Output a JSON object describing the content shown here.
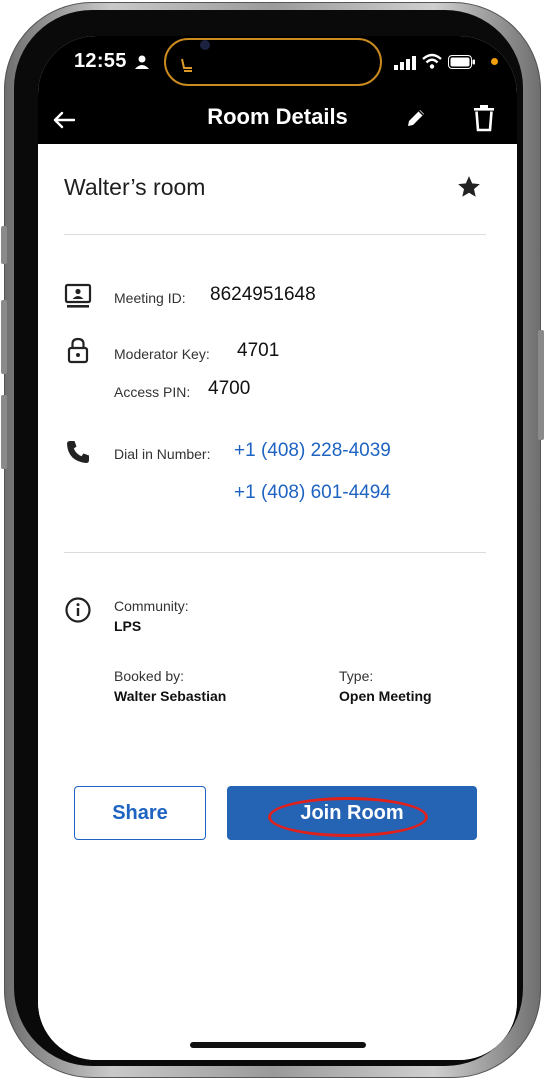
{
  "status_bar": {
    "time": "12:55"
  },
  "app_bar": {
    "title": "Room Details"
  },
  "room": {
    "name": "Walter’s room",
    "meeting_id_label": "Meeting ID:",
    "meeting_id": "8624951648",
    "moderator_key_label": "Moderator Key:",
    "moderator_key": "4701",
    "access_pin_label": "Access PIN:",
    "access_pin": "4700",
    "dial_in_label": "Dial in Number:",
    "dial_in_numbers": [
      "+1 (408) 228-4039",
      "+1 (408) 601-4494"
    ],
    "community_label": "Community:",
    "community": "LPS",
    "booked_by_label": "Booked by:",
    "booked_by": "Walter Sebastian",
    "type_label": "Type:",
    "type": "Open Meeting"
  },
  "actions": {
    "share_label": "Share",
    "join_label": "Join Room"
  },
  "colors": {
    "accent": "#2563b4",
    "link": "#1e63c2",
    "highlight": "#e0201b",
    "app_bar": "#000000"
  },
  "icons": [
    "back-arrow-icon",
    "pencil-icon",
    "trash-icon",
    "star-icon",
    "screen-share-icon",
    "lock-icon",
    "phone-icon",
    "info-icon"
  ]
}
